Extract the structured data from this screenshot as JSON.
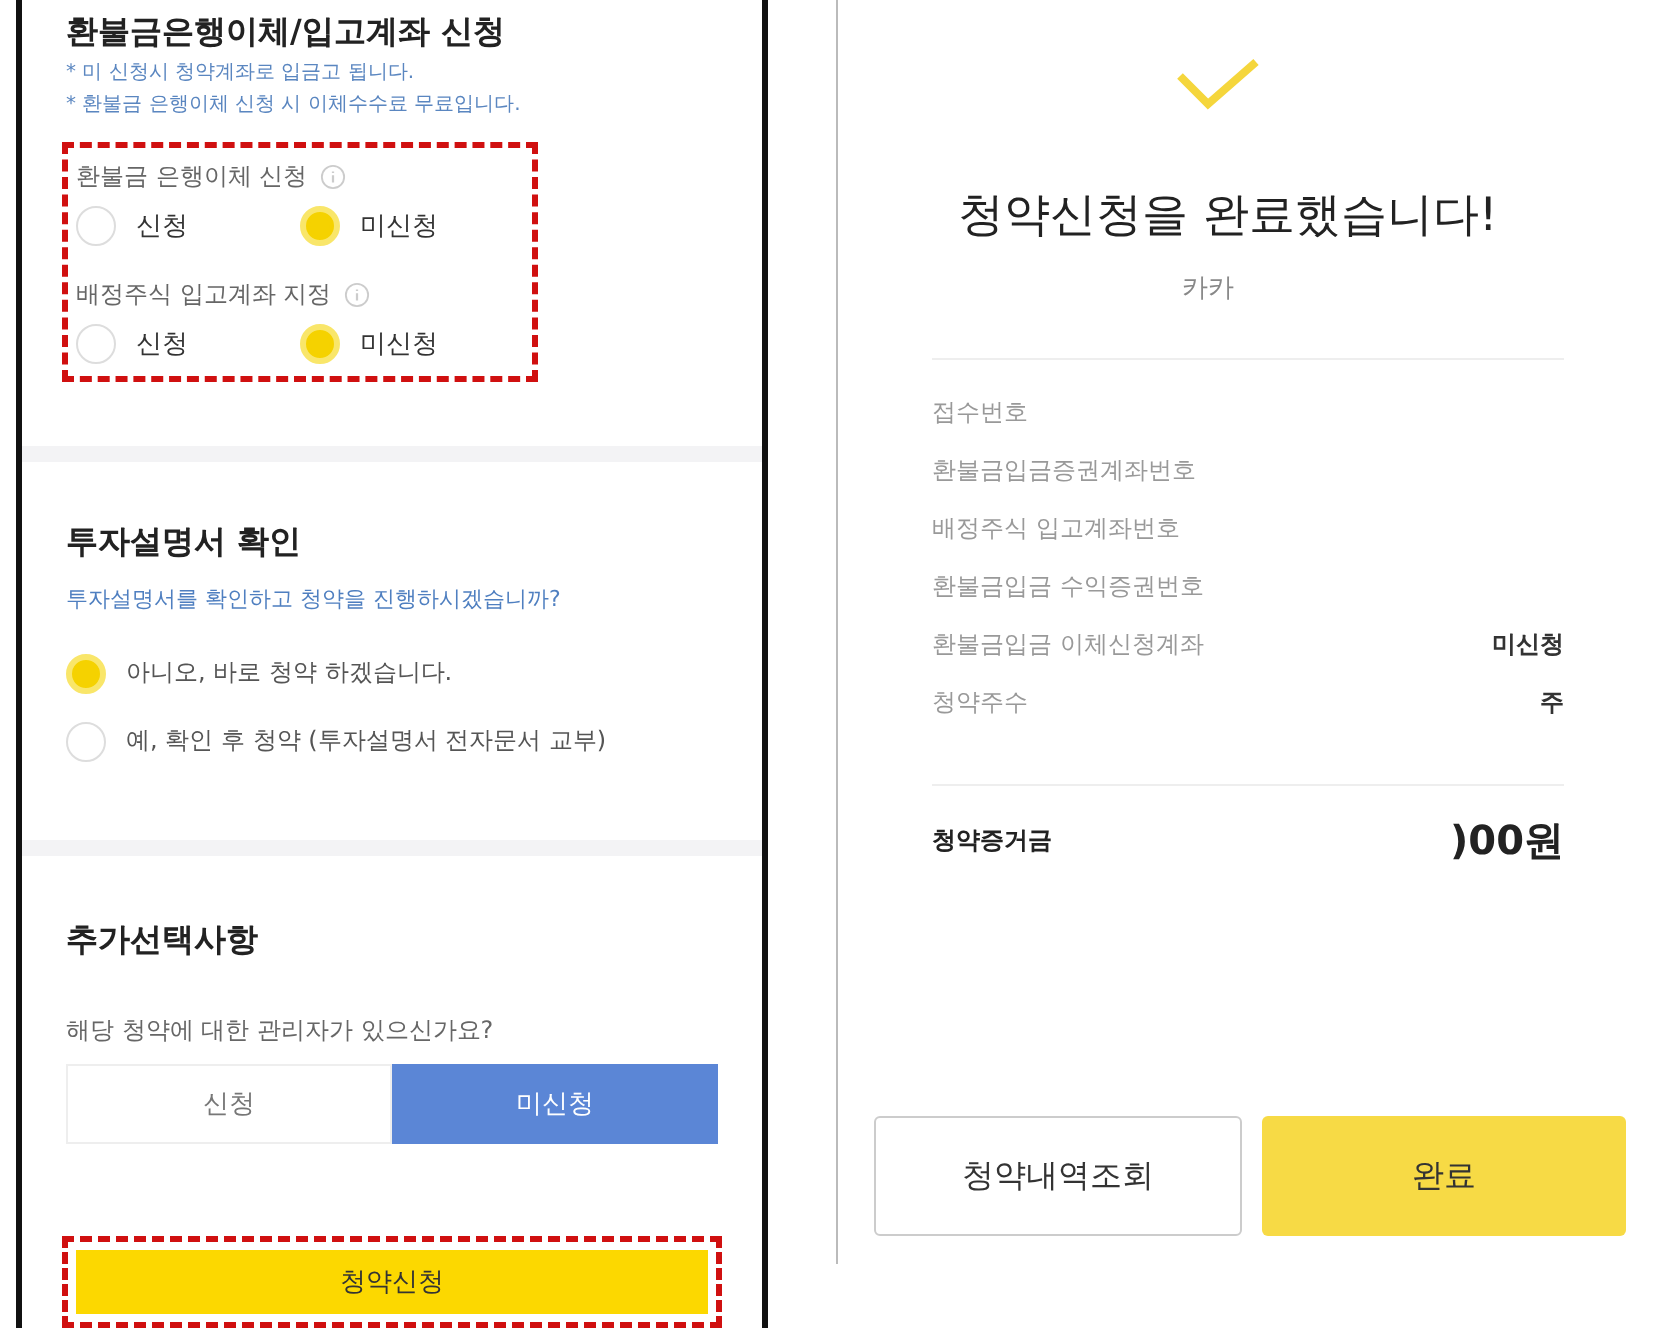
{
  "left": {
    "refund": {
      "title": "환불금은행이체/입고계좌 신청",
      "notes": [
        "* 미 신청시 청약계좌로 입금고 됩니다.",
        "* 환불금 은행이체 신청 시 이체수수료 무료입니다."
      ],
      "highlighted": true,
      "groups": [
        {
          "label": "환불금 은행이체 신청",
          "options": [
            {
              "label": "신청",
              "selected": false
            },
            {
              "label": "미신청",
              "selected": true
            }
          ]
        },
        {
          "label": "배정주식 입고계좌 지정",
          "options": [
            {
              "label": "신청",
              "selected": false
            },
            {
              "label": "미신청",
              "selected": true
            }
          ]
        }
      ]
    },
    "prospectus": {
      "title": "투자설명서 확인",
      "question": "투자설명서를 확인하고 청약을 진행하시겠습니까?",
      "options": [
        {
          "label": "아니오, 바로 청약 하겠습니다.",
          "selected": true
        },
        {
          "label": "예, 확인 후 청약 (투자설명서 전자문서 교부)",
          "selected": false
        }
      ]
    },
    "extra": {
      "title": "추가선택사항",
      "question": "해당 청약에 대한 관리자가 있으신가요?",
      "options": [
        {
          "label": "신청",
          "selected": false
        },
        {
          "label": "미신청",
          "selected": true
        }
      ]
    },
    "submit": {
      "label": "청약신청",
      "highlighted": true
    }
  },
  "right": {
    "title": "청약신청을 완료했습니다!",
    "subtitle": "카카",
    "rows": [
      {
        "label": "접수번호"
      },
      {
        "label": "환불금입금증권계좌번호"
      },
      {
        "label": "배정주식 입고계좌번호"
      },
      {
        "label": "환불금입금 수익증권번호"
      },
      {
        "label": "환불금입금 이체신청계좌",
        "value": "미신청"
      },
      {
        "label": "청약주수",
        "value": "주"
      }
    ],
    "total": {
      "label": "청약증거금",
      "value": ")00원"
    },
    "buttons": [
      {
        "label": "청약내역조회",
        "kind": "secondary"
      },
      {
        "label": "완료",
        "kind": "primary"
      }
    ]
  }
}
